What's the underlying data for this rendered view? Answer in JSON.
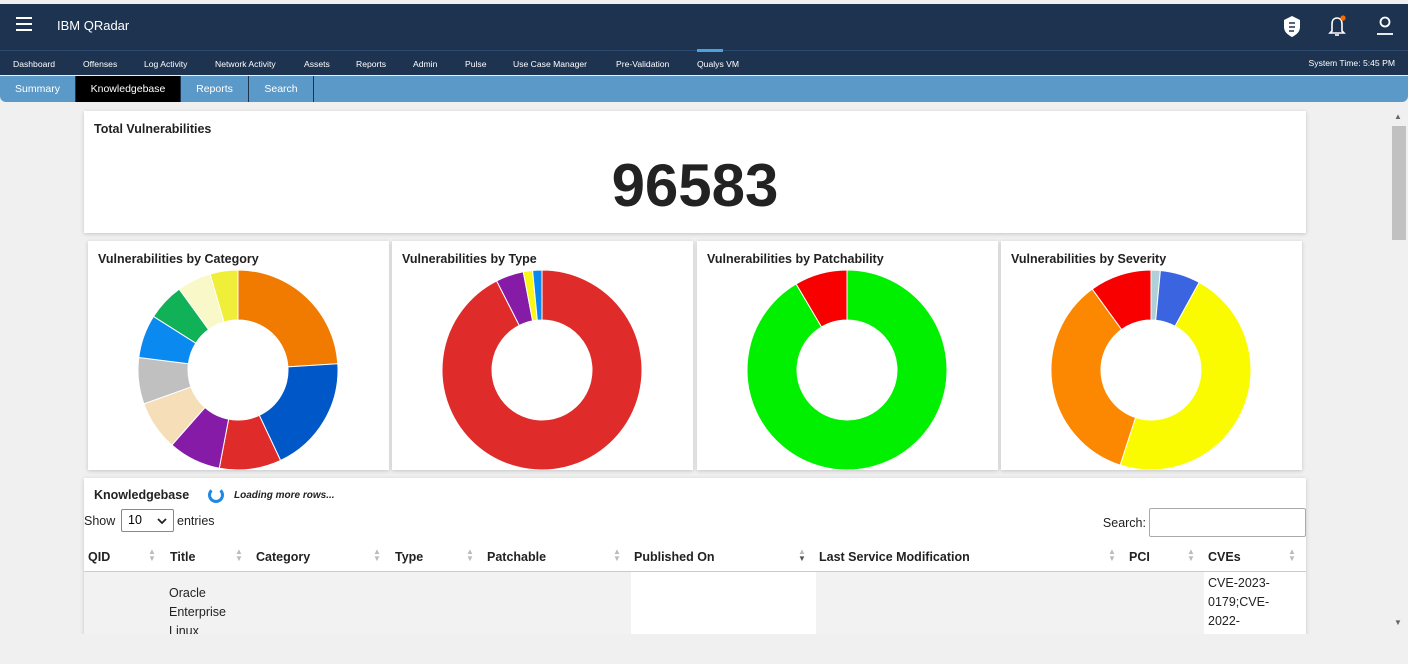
{
  "app": {
    "title": "IBM QRadar"
  },
  "topbar_icons": [
    "shield-icon",
    "notification-bell-icon",
    "user-profile-icon"
  ],
  "nav": {
    "items": [
      "Dashboard",
      "Offenses",
      "Log Activity",
      "Network Activity",
      "Assets",
      "Reports",
      "Admin",
      "Pulse",
      "Use Case Manager",
      "Pre-Validation",
      "Qualys VM"
    ],
    "active": "Qualys VM",
    "system_time": "System Time: 5:45 PM"
  },
  "subnav": {
    "tabs": [
      "Summary",
      "Knowledgebase",
      "Reports",
      "Search"
    ],
    "active": "Knowledgebase"
  },
  "total": {
    "title": "Total Vulnerabilities",
    "value": "96583"
  },
  "charts": {
    "category_title": "Vulnerabilities by Category",
    "type_title": "Vulnerabilities by Type",
    "patchability_title": "Vulnerabilities by Patchability",
    "severity_title": "Vulnerabilities by Severity"
  },
  "chart_data": [
    {
      "type": "pie",
      "title": "Vulnerabilities by Category",
      "slices": [
        {
          "value": 24,
          "color": "#f07b00"
        },
        {
          "value": 19,
          "color": "#0057c8"
        },
        {
          "value": 10,
          "color": "#e02b2b"
        },
        {
          "value": 8.5,
          "color": "#861ba8"
        },
        {
          "value": 8,
          "color": "#f5deb8"
        },
        {
          "value": 7.5,
          "color": "#c0c0c0"
        },
        {
          "value": 7,
          "color": "#0a8af0"
        },
        {
          "value": 6,
          "color": "#11b157"
        },
        {
          "value": 5.5,
          "color": "#f8f8c8"
        },
        {
          "value": 4.5,
          "color": "#efef39"
        }
      ]
    },
    {
      "type": "pie",
      "title": "Vulnerabilities by Type",
      "slices": [
        {
          "value": 92.5,
          "color": "#e02b2b"
        },
        {
          "value": 4.5,
          "color": "#861ba8"
        },
        {
          "value": 1.5,
          "color": "#f8f814"
        },
        {
          "value": 1.5,
          "color": "#0a8af0"
        }
      ]
    },
    {
      "type": "pie",
      "title": "Vulnerabilities by Patchability",
      "slices": [
        {
          "value": 91.5,
          "color": "#00f000"
        },
        {
          "value": 8.5,
          "color": "#f80000"
        }
      ]
    },
    {
      "type": "pie",
      "title": "Vulnerabilities by Severity",
      "slices": [
        {
          "value": 1.5,
          "color": "#b0d0d8"
        },
        {
          "value": 6.5,
          "color": "#3a64e0"
        },
        {
          "value": 47,
          "color": "#fbfb00"
        },
        {
          "value": 35,
          "color": "#fb8800"
        },
        {
          "value": 10,
          "color": "#f80000"
        }
      ]
    }
  ],
  "kb": {
    "title": "Knowledgebase",
    "loading": "Loading more rows...",
    "show_label": "Show",
    "show_value": "10",
    "entries_label": "entries",
    "search_label": "Search:",
    "columns": [
      "QID",
      "Title",
      "Category",
      "Type",
      "Patchable",
      "Published On",
      "Last Service Modification",
      "PCI",
      "CVEs"
    ],
    "row": {
      "title": "Oracle\nEnterprise\nLinux",
      "cves": "CVE-2023-\n0179;CVE-\n2022-"
    }
  }
}
